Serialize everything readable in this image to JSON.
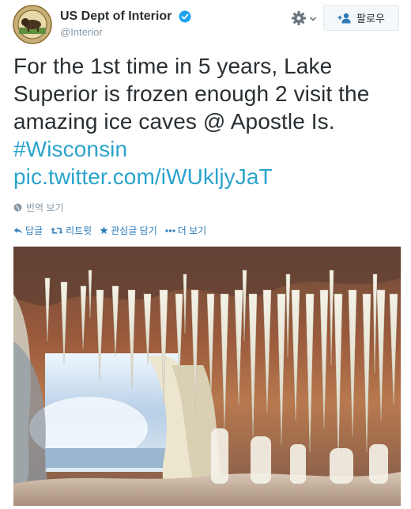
{
  "account": {
    "display_name": "US Dept of Interior",
    "handle": "@Interior",
    "verified": true
  },
  "follow_button": {
    "label": "팔로우"
  },
  "tweet": {
    "lines": [
      "For the 1st time in 5 years, Lake",
      "Superior is frozen enough 2 visit the",
      "amazing ice caves @ Apostle Is."
    ],
    "hashtag": "#Wisconsin",
    "link": "pic.twitter.com/iWUkljyJaT"
  },
  "translate": {
    "label": "번역 보기"
  },
  "actions": {
    "reply": "답글",
    "retweet": "리트윗",
    "favorite": "관심글 담기",
    "more": "더 보기"
  },
  "colors": {
    "link": "#2ba4cc",
    "action": "#2b7bb9",
    "verified": "#1da1f2"
  },
  "icons": [
    "seal-icon",
    "verified-badge-icon",
    "gear-icon",
    "chevron-down-icon",
    "add-user-icon",
    "globe-icon",
    "reply-icon",
    "retweet-icon",
    "star-icon",
    "more-dots-icon"
  ]
}
